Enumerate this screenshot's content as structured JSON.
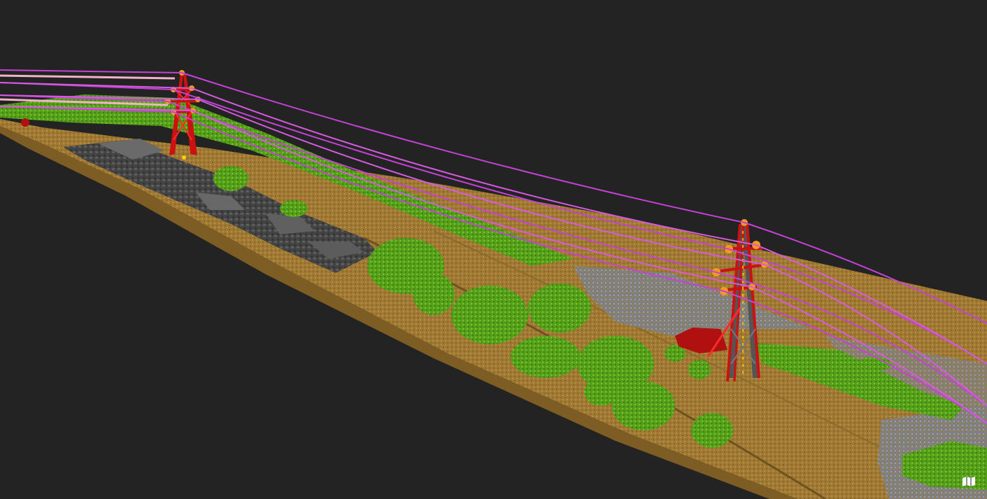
{
  "viewer": {
    "background_color": "#232323",
    "classification_colors": {
      "ground": "#a07a35",
      "ground_light": "#b8903f",
      "vegetation": "#5aa31c",
      "vegetation_light": "#7cc42a",
      "building": "#4b4b4b",
      "building_light": "#6a6a6a",
      "rock": "#8a8a8a",
      "tower": "#cc1111",
      "tower_lattice": "#555555",
      "insulator": "#f39a1c",
      "conductor": "#c542d6",
      "conductor_light": "#e07ae8",
      "highlight": "#b01010"
    },
    "objects": {
      "towers": [
        "transmission-tower-1",
        "transmission-tower-2"
      ],
      "conductor_count": 7
    }
  },
  "controls": {
    "map_icon": "map-icon"
  }
}
